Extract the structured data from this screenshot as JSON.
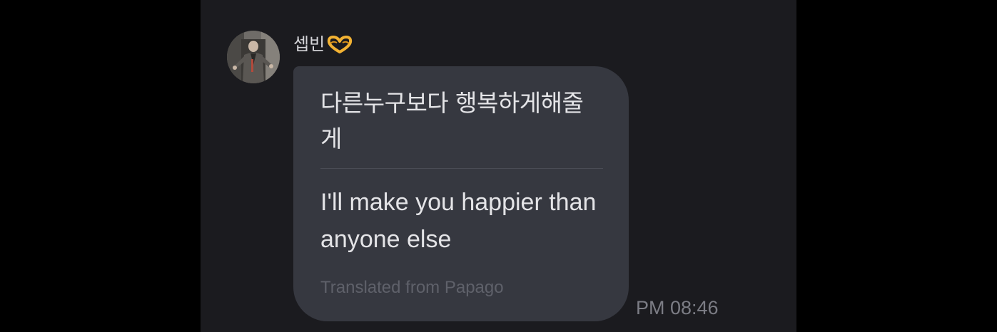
{
  "message": {
    "sender_name": "셉빈",
    "sender_emoji_icon": "heart-hands-icon",
    "avatar_icon": "profile-photo-avatar",
    "original_text": "다른누구보다 행복하게해줄게",
    "translated_text": "I'll make you happier than anyone else",
    "translation_credit": "Translated from Papago",
    "timestamp": "PM 08:46"
  },
  "colors": {
    "page_background": "#000000",
    "chat_background": "#1b1b1f",
    "bubble_background": "#363840",
    "primary_text": "#e4e4e7",
    "muted_text": "#5f616a",
    "timestamp_text": "#7c7d85"
  }
}
